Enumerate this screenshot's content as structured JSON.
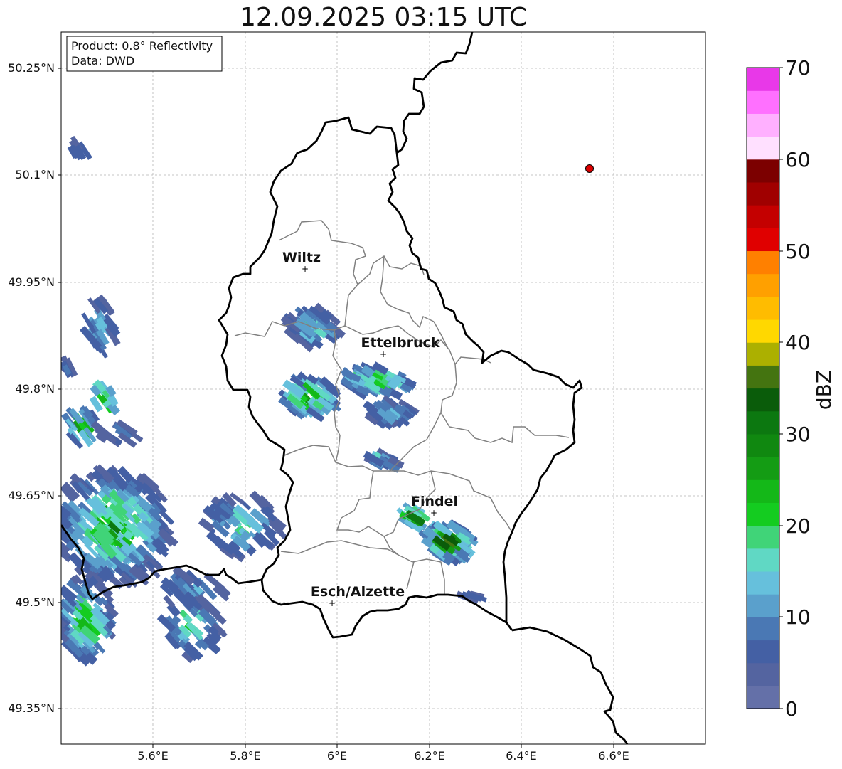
{
  "title": "12.09.2025 03:15 UTC",
  "info_box": {
    "product": "Product: 0.8° Reflectivity",
    "data": "Data: DWD"
  },
  "axes": {
    "lon_ticks": [
      "5.6°E",
      "5.8°E",
      "6°E",
      "6.2°E",
      "6.4°E",
      "6.6°E"
    ],
    "lat_ticks": [
      "50.25°N",
      "50.1°N",
      "49.95°N",
      "49.8°N",
      "49.65°N",
      "49.5°N",
      "49.35°N"
    ],
    "grid": true
  },
  "cities": [
    {
      "name": "Wiltz"
    },
    {
      "name": "Ettelbruck"
    },
    {
      "name": "Findel"
    },
    {
      "name": "Esch/Alzette"
    }
  ],
  "radar_marker": {
    "color": "#dd0000"
  },
  "colorbar": {
    "title": "dBZ",
    "tick_labels": [
      "0",
      "10",
      "20",
      "30",
      "40",
      "50",
      "60",
      "70"
    ],
    "colors": [
      "#6470a8",
      "#5464a0",
      "#4460a4",
      "#4a78b4",
      "#5aa0cc",
      "#66c0dc",
      "#60d8c4",
      "#40d478",
      "#14cc20",
      "#14b818",
      "#149c14",
      "#108810",
      "#0c7810",
      "#0a5c0a",
      "#447410",
      "#acb000",
      "#ffd800",
      "#ffbc00",
      "#ffa000",
      "#ff8000",
      "#e00000",
      "#c40000",
      "#a00000",
      "#7c0000",
      "#ffe0ff",
      "#ffb0ff",
      "#ff70ff",
      "#e838e8"
    ]
  }
}
